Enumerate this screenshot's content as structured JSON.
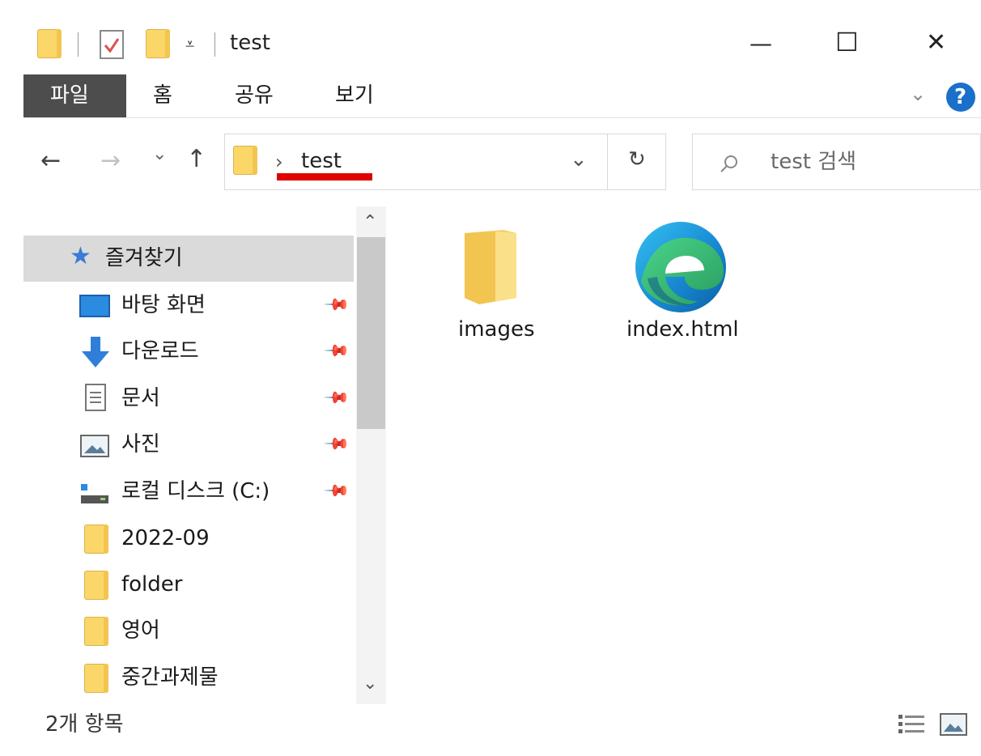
{
  "window": {
    "title": "test",
    "minimize": "—",
    "maximize": "☐",
    "close": "✕"
  },
  "ribbon": {
    "tabs": [
      {
        "label": "파일"
      },
      {
        "label": "홈"
      },
      {
        "label": "공유"
      },
      {
        "label": "보기"
      }
    ],
    "expand": "⌄",
    "help": "?"
  },
  "nav": {
    "back": "←",
    "forward": "→",
    "recent": "⌄",
    "up": "↑"
  },
  "address": {
    "path": "test",
    "chevron": "›",
    "dropdown": "⌄",
    "refresh": "↻"
  },
  "search": {
    "placeholder": "test 검색"
  },
  "sidebar": {
    "favorites": "즐겨찾기",
    "items": [
      {
        "label": "바탕 화면",
        "icon": "desktop-icon",
        "pinned": true
      },
      {
        "label": "다운로드",
        "icon": "download-icon",
        "pinned": true
      },
      {
        "label": "문서",
        "icon": "document-icon",
        "pinned": true
      },
      {
        "label": "사진",
        "icon": "pictures-icon",
        "pinned": true
      },
      {
        "label": "로컬 디스크 (C:)",
        "icon": "drive-icon",
        "pinned": true
      },
      {
        "label": "2022-09",
        "icon": "folder-icon",
        "pinned": false
      },
      {
        "label": "folder",
        "icon": "folder-icon",
        "pinned": false
      },
      {
        "label": "영어",
        "icon": "folder-icon",
        "pinned": false
      },
      {
        "label": "중간과제물",
        "icon": "folder-icon",
        "pinned": false
      }
    ]
  },
  "content": {
    "files": [
      {
        "name": "images",
        "type": "folder"
      },
      {
        "name": "index.html",
        "type": "edge-html"
      }
    ]
  },
  "status": {
    "count": "2개 항목"
  },
  "colors": {
    "file_tab_bg": "#4d4d4d",
    "help_blue": "#1a6fc9",
    "underline_red": "#e00000",
    "folder_yellow": "#fbd76a"
  }
}
